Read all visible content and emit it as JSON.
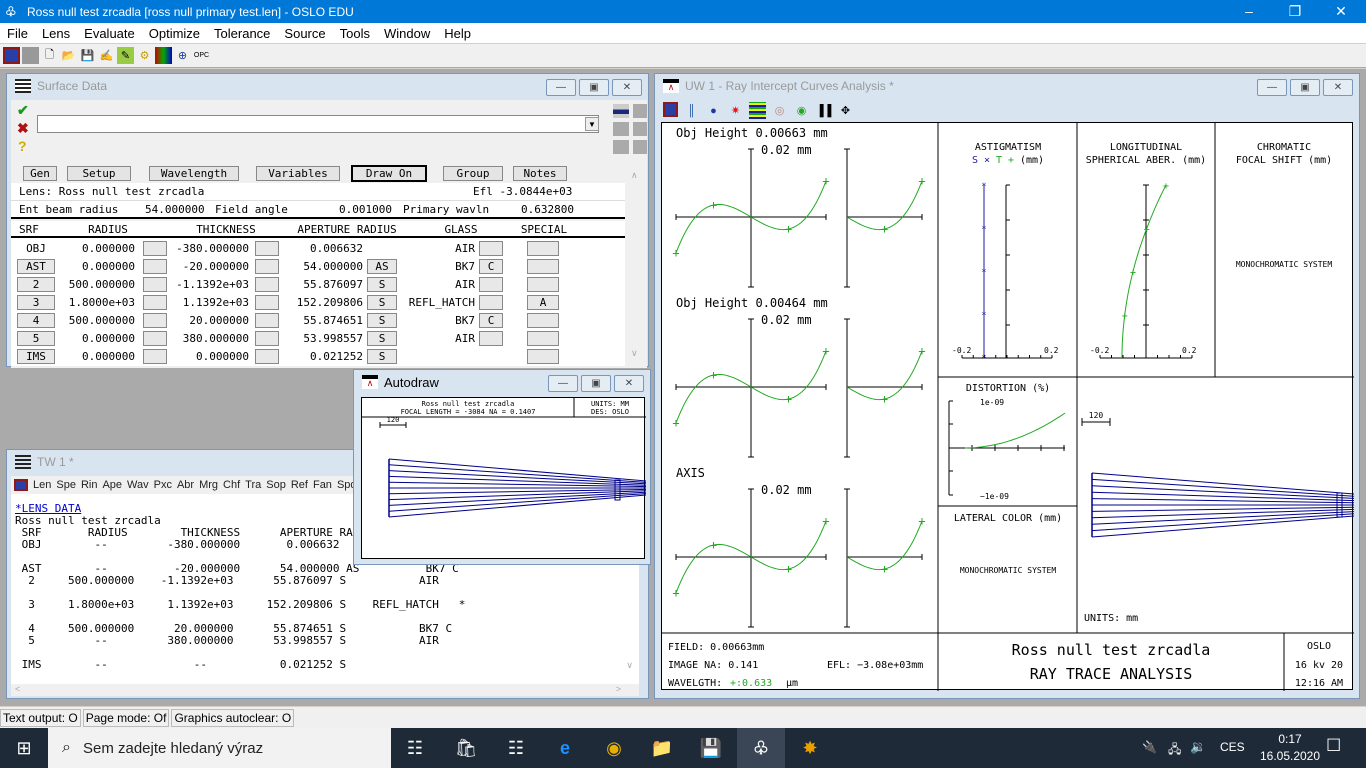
{
  "app": {
    "title": "Ross null test zrcadla [ross null primary test.len] - OSLO EDU",
    "icon": "oslo-icon"
  },
  "menu": [
    "File",
    "Lens",
    "Evaluate",
    "Optimize",
    "Tolerance",
    "Source",
    "Tools",
    "Window",
    "Help"
  ],
  "toolbar_icons": [
    "spreadsheet-icon",
    "blank-icon",
    "new-icon",
    "open-icon",
    "save-icon",
    "edit-icon",
    "notepad-icon",
    "gears-icon",
    "colors-icon",
    "target-icon",
    "opc-icon"
  ],
  "surface_data": {
    "title": "Surface Data",
    "command_value": "",
    "buttons": [
      "Gen",
      "Setup",
      "Wavelength",
      "Variables",
      "Draw On",
      "Group",
      "Notes"
    ],
    "lens_label": "Lens: Ross null test zrcadla",
    "efl": "Efl -3.0844e+03",
    "ent_beam_label": "Ent beam radius",
    "ent_beam_value": "54.000000",
    "field_angle_label": "Field angle",
    "field_angle_value": "0.001000",
    "primary_wavln_label": "Primary wavln",
    "primary_wavln_value": "0.632800",
    "headers": [
      "SRF",
      "RADIUS",
      "THICKNESS",
      "APERTURE RADIUS",
      "GLASS",
      "SPECIAL"
    ],
    "rows": [
      {
        "srf": "OBJ",
        "radius": "0.000000",
        "thickness": "-380.000000",
        "aperture": "0.006632",
        "ap_flag": "",
        "glass": "AIR",
        "glass_flag": "",
        "special": ""
      },
      {
        "srf": "AST",
        "radius": "0.000000",
        "thickness": "-20.000000",
        "aperture": "54.000000",
        "ap_flag": "AS",
        "glass": "BK7",
        "glass_flag": "C",
        "special": ""
      },
      {
        "srf": "2",
        "radius": "500.000000",
        "thickness": "-1.1392e+03",
        "aperture": "55.876097",
        "ap_flag": "S",
        "glass": "AIR",
        "glass_flag": "",
        "special": ""
      },
      {
        "srf": "3",
        "radius": "1.8000e+03",
        "thickness": "1.1392e+03",
        "aperture": "152.209806",
        "ap_flag": "S",
        "glass": "REFL_HATCH",
        "glass_flag": "",
        "special": "A"
      },
      {
        "srf": "4",
        "radius": "500.000000",
        "thickness": "20.000000",
        "aperture": "55.874651",
        "ap_flag": "S",
        "glass": "BK7",
        "glass_flag": "C",
        "special": ""
      },
      {
        "srf": "5",
        "radius": "0.000000",
        "thickness": "380.000000",
        "aperture": "53.998557",
        "ap_flag": "S",
        "glass": "AIR",
        "glass_flag": "",
        "special": ""
      },
      {
        "srf": "IMS",
        "radius": "0.000000",
        "thickness": "0.000000",
        "aperture": "0.021252",
        "ap_flag": "S",
        "glass": "",
        "glass_flag": "",
        "special": ""
      }
    ]
  },
  "tw": {
    "title": "TW 1 *",
    "tabs": [
      "Len",
      "Spe",
      "Rin",
      "Ape",
      "Wav",
      "Pxc",
      "Abr",
      "Mrg",
      "Chf",
      "Tra",
      "Sop",
      "Ref",
      "Fan",
      "Spd"
    ],
    "link": "*LENS DATA",
    "text": "Ross null test zrcadla\n SRF       RADIUS        THICKNESS      APERTURE RADIUS     GLASS      SPE\n OBJ        --         -380.000000       0.006632\n\n AST        --          -20.000000      54.000000 AS          BK7 C\n  2     500.000000    -1.1392e+03      55.876097 S           AIR\n\n  3     1.8000e+03     1.1392e+03     152.209806 S    REFL_HATCH   *\n\n  4     500.000000      20.000000      55.874651 S           BK7 C\n  5         --         380.000000      53.998557 S           AIR\n\n IMS        --             --           0.021252 S"
  },
  "autodraw": {
    "title": "Autodraw",
    "header_line1": "Ross null test zrcadla",
    "header_line2": "FOCAL LENGTH = -3084   NA = 0.1407",
    "units": "UNITS: MM",
    "des": "DES: OSLO",
    "scale": "120"
  },
  "uw": {
    "title": "UW 1 - Ray Intercept Curves Analysis *",
    "fans": [
      {
        "label": "Obj Height 0.00663 mm",
        "scale": "0.02 mm"
      },
      {
        "label": "Obj Height 0.00464 mm",
        "scale": "0.02 mm"
      },
      {
        "label": "AXIS",
        "scale": "0.02 mm"
      }
    ],
    "astig": {
      "title": "ASTIGMATISM",
      "legend_s": "S",
      "legend_x": "×",
      "legend_t": "T",
      "legend_plus": "+",
      "unit": "(mm)",
      "xmin": "-0.2",
      "xmax": "0.2"
    },
    "lsa": {
      "title1": "LONGITUDINAL",
      "title2": "SPHERICAL ABER. (mm)",
      "xmin": "-0.2",
      "xmax": "0.2"
    },
    "chrom": {
      "title1": "CHROMATIC",
      "title2": "FOCAL SHIFT (mm)",
      "msg": "MONOCHROMATIC SYSTEM"
    },
    "dist": {
      "title": "DISTORTION (%)",
      "ymax": "1e-09",
      "ymin": "−1e-09"
    },
    "latcol": {
      "title": "LATERAL COLOR (mm)",
      "msg": "MONOCHROMATIC SYSTEM"
    },
    "layout": {
      "scale": "120",
      "units": "UNITS: mm"
    },
    "footer": {
      "field": "FIELD: 0.00663mm",
      "image_na": "IMAGE NA: 0.141",
      "efl": "EFL: −3.08e+03mm",
      "wavelength_label": "WAVELGTH:",
      "wavelength_value": "+:0.633",
      "wavelength_unit": "µm",
      "title1": "Ross null test zrcadla",
      "title2": "RAY TRACE ANALYSIS",
      "prog": "OSLO",
      "date": "16 kv 20",
      "time": "12:16 AM"
    }
  },
  "status": [
    "Text output: O",
    "Page mode: Of",
    "Graphics autoclear: O"
  ],
  "taskbar": {
    "search_placeholder": "Sem zadejte hledaný výraz",
    "lang": "CES",
    "time": "0:17",
    "date": "16.05.2020"
  },
  "colors": {
    "titlebar": "#0078d7",
    "curve": "#22aa22",
    "ray": "#00008b",
    "astig_s": "#1a1aa0"
  }
}
